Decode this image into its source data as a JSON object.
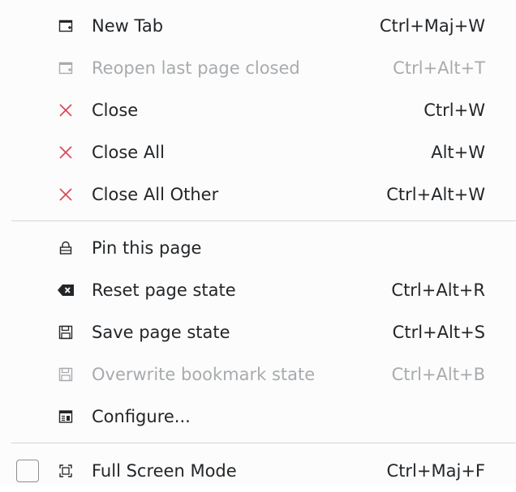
{
  "menu": {
    "items": [
      {
        "label": "New Tab",
        "shortcut": "Ctrl+Maj+W",
        "icon": "new-tab-icon",
        "enabled": true
      },
      {
        "label": "Reopen last page closed",
        "shortcut": "Ctrl+Alt+T",
        "icon": "reopen-tab-icon",
        "enabled": false
      },
      {
        "label": "Close",
        "shortcut": "Ctrl+W",
        "icon": "close-icon",
        "enabled": true
      },
      {
        "label": "Close All",
        "shortcut": "Alt+W",
        "icon": "close-all-icon",
        "enabled": true
      },
      {
        "label": "Close All Other",
        "shortcut": "Ctrl+Alt+W",
        "icon": "close-other-icon",
        "enabled": true
      },
      {
        "label": "Pin this page",
        "shortcut": "",
        "icon": "lock-icon",
        "enabled": true
      },
      {
        "label": "Reset page state",
        "shortcut": "Ctrl+Alt+R",
        "icon": "backspace-icon",
        "enabled": true
      },
      {
        "label": "Save page state",
        "shortcut": "Ctrl+Alt+S",
        "icon": "save-icon",
        "enabled": true
      },
      {
        "label": "Overwrite bookmark state",
        "shortcut": "Ctrl+Alt+B",
        "icon": "overwrite-save-icon",
        "enabled": false
      },
      {
        "label": "Configure...",
        "shortcut": "",
        "icon": "configure-icon",
        "enabled": true
      },
      {
        "label": "Full Screen Mode",
        "shortcut": "Ctrl+Maj+F",
        "icon": "fullscreen-icon",
        "enabled": true,
        "checked": false
      }
    ],
    "colors": {
      "text": "#232629",
      "disabled": "#a8abae",
      "close_icon": "#da4453",
      "separator": "#d5d6d7"
    }
  }
}
